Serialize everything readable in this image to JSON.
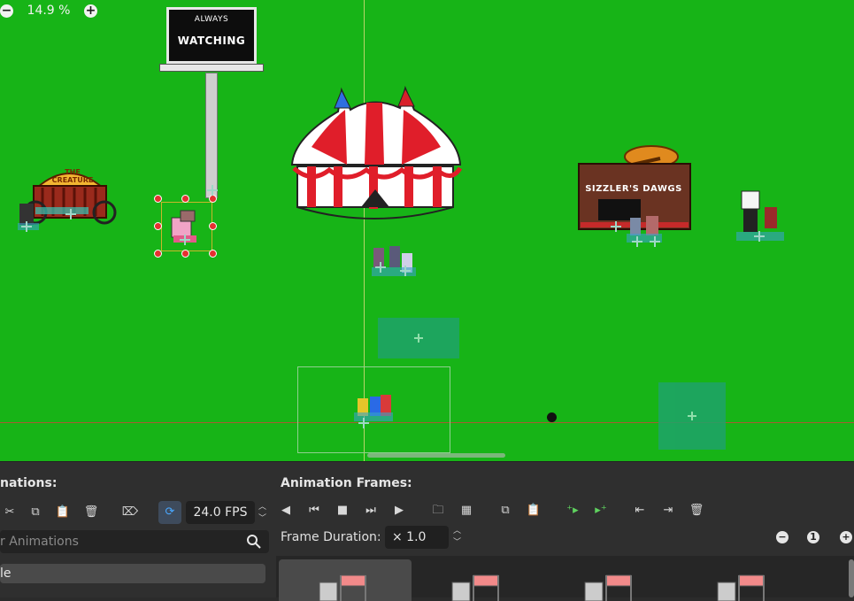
{
  "canvas": {
    "zoom": "14.9 %",
    "sign_line1": "ALWAYS",
    "sign_line2": "WATCHING",
    "creature_label": "THE CREATURE",
    "booth_label": "SIZZLER'S DAWGS",
    "bg_color": "#17b417"
  },
  "left_panel": {
    "title": "nations:",
    "fps": "24.0 FPS",
    "search_placeholder": "r Animations",
    "selected_item": "le"
  },
  "frames_panel": {
    "title": "Animation Frames:",
    "frame_duration_label": "Frame Duration:",
    "frame_duration_value": "× 1.0",
    "zoom_reset": "1"
  },
  "icons": [
    "zoom-out-icon",
    "zoom-in-icon",
    "cut-icon",
    "copy-icon",
    "paste-icon",
    "delete-icon",
    "rename-icon",
    "loop-icon",
    "play-back-icon",
    "prev-frame-icon",
    "stop-icon",
    "next-frame-icon",
    "play-icon",
    "folder-icon",
    "grid-icon",
    "move-left-icon",
    "move-right-icon"
  ]
}
